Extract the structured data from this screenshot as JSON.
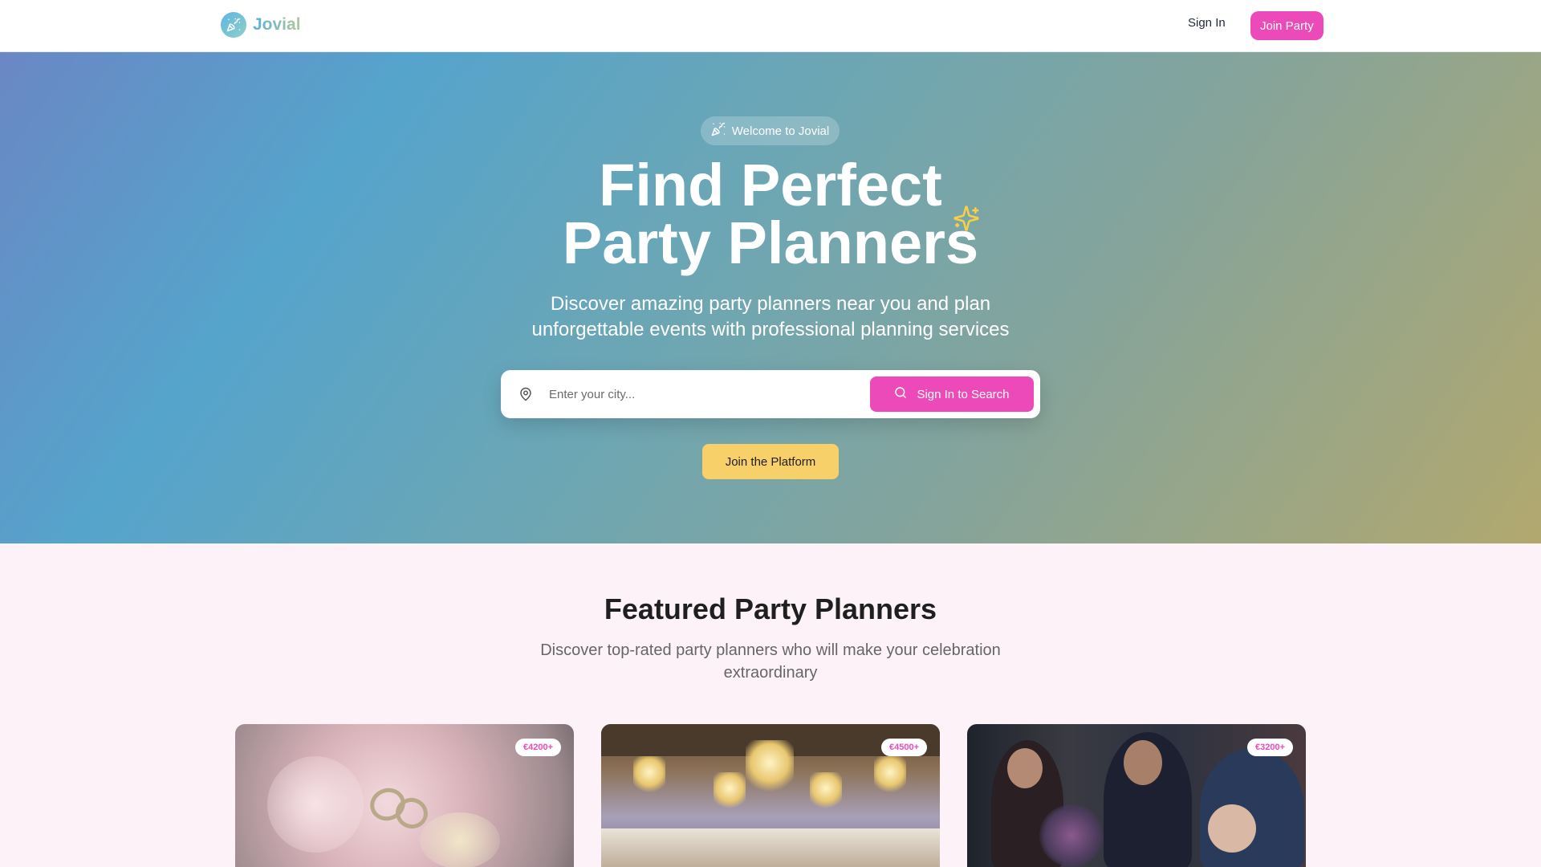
{
  "nav": {
    "brand_name": "Jovial",
    "sign_in_label": "Sign In",
    "join_label": "Join Party"
  },
  "hero": {
    "welcome_badge": "Welcome to Jovial",
    "title_line1": "Find Perfect",
    "title_line2": "Party Planners",
    "subtitle_line1": "Discover amazing party planners near you and plan",
    "subtitle_line2": "unforgettable events with professional planning services",
    "search": {
      "placeholder": "Enter your city...",
      "value": "",
      "button_label": "Sign In to Search"
    },
    "join_platform_label": "Join the Platform"
  },
  "featured": {
    "title": "Featured Party Planners",
    "subtitle_line1": "Discover top-rated party planners who will make your celebration",
    "subtitle_line2": "extraordinary",
    "cards": [
      {
        "price": "€4200+"
      },
      {
        "price": "€4500+"
      },
      {
        "price": "€3200+"
      }
    ]
  },
  "colors": {
    "accent_pink": "#ec4ab8",
    "accent_yellow": "#f8d06a",
    "sparkle_yellow": "#f6d148"
  },
  "icons": [
    "party-popper-icon",
    "sparkles-icon",
    "map-pin-icon",
    "search-icon"
  ]
}
